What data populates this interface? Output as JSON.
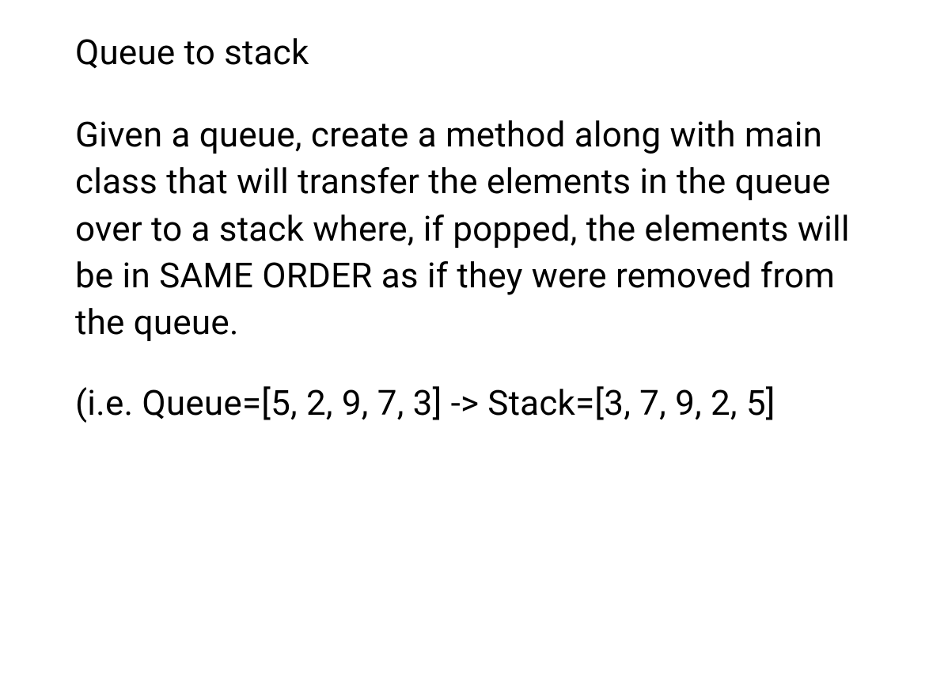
{
  "title": "Queue to stack",
  "paragraph": "Given a queue, create a method along with main class that will transfer the elements in the queue over to a stack where, if popped, the elements will be in SAME ORDER as if they were removed from the queue.",
  "example": "(i.e. Queue=[5, 2, 9, 7, 3] -> Stack=[3, 7, 9, 2, 5]"
}
